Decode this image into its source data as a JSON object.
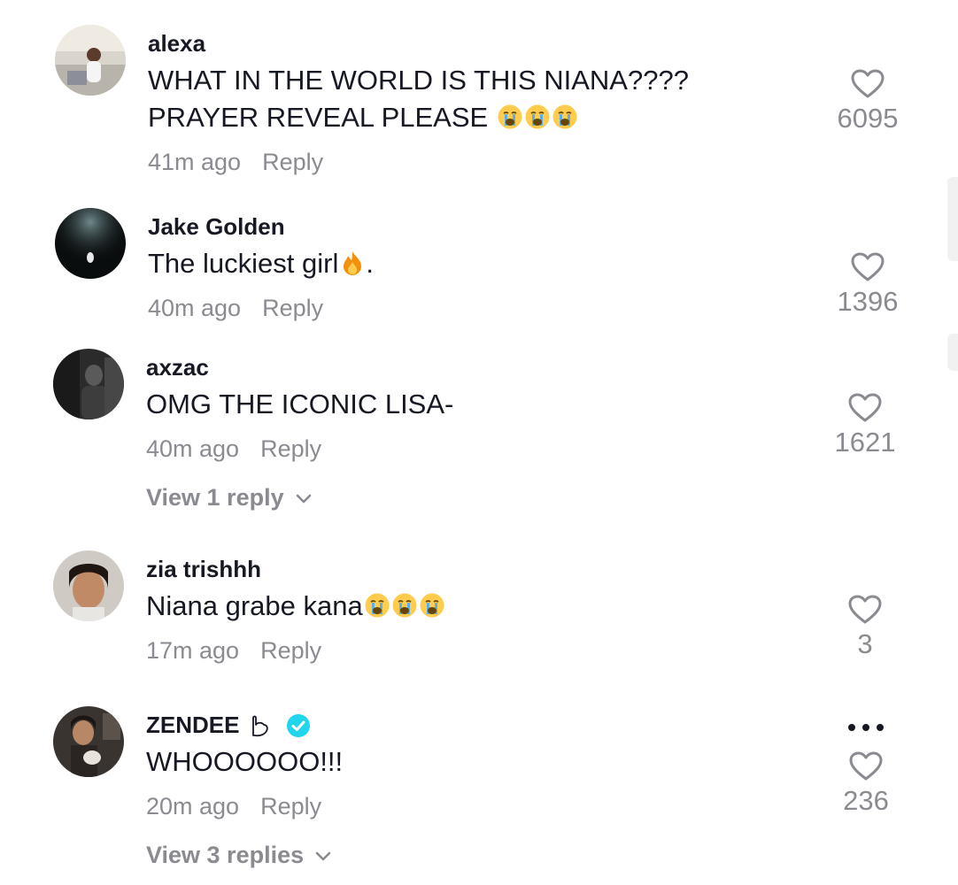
{
  "comments": [
    {
      "username": "alexa",
      "text": "WHAT IN THE WORLD IS THIS NIANA???? PRAYER REVEAL PLEASE",
      "emojis": [
        "loudly-crying-face",
        "loudly-crying-face",
        "loudly-crying-face"
      ],
      "time": "41m ago",
      "reply_label": "Reply",
      "likes": "6095"
    },
    {
      "username": "Jake Golden",
      "text": "The luckiest girl",
      "emojis": [
        "fire"
      ],
      "text_suffix": ".",
      "time": "40m ago",
      "reply_label": "Reply",
      "likes": "1396"
    },
    {
      "username": "axzac",
      "text": "OMG THE ICONIC LISA-",
      "time": "40m ago",
      "reply_label": "Reply",
      "likes": "1621",
      "view_replies": "View 1 reply"
    },
    {
      "username": "zia trishhh",
      "text": "Niana grabe kana",
      "emojis": [
        "loudly-crying-face",
        "loudly-crying-face",
        "loudly-crying-face"
      ],
      "time": "17m ago",
      "reply_label": "Reply",
      "likes": "3"
    },
    {
      "username": "ZENDEE",
      "verified": true,
      "text": "WHOOOOOO!!!",
      "time": "20m ago",
      "reply_label": "Reply",
      "likes": "236",
      "view_replies": "View 3 replies"
    }
  ],
  "icons": {
    "like": "heart-outline-icon",
    "more": "more-options-icon",
    "expand": "chevron-down-icon",
    "verified": "verified-badge-icon"
  },
  "colors": {
    "text": "#161823",
    "muted": "#8a8b91",
    "verified": "#20d5ec",
    "emoji_face": "#ffcc4d",
    "emoji_tears": "#5dadec"
  }
}
